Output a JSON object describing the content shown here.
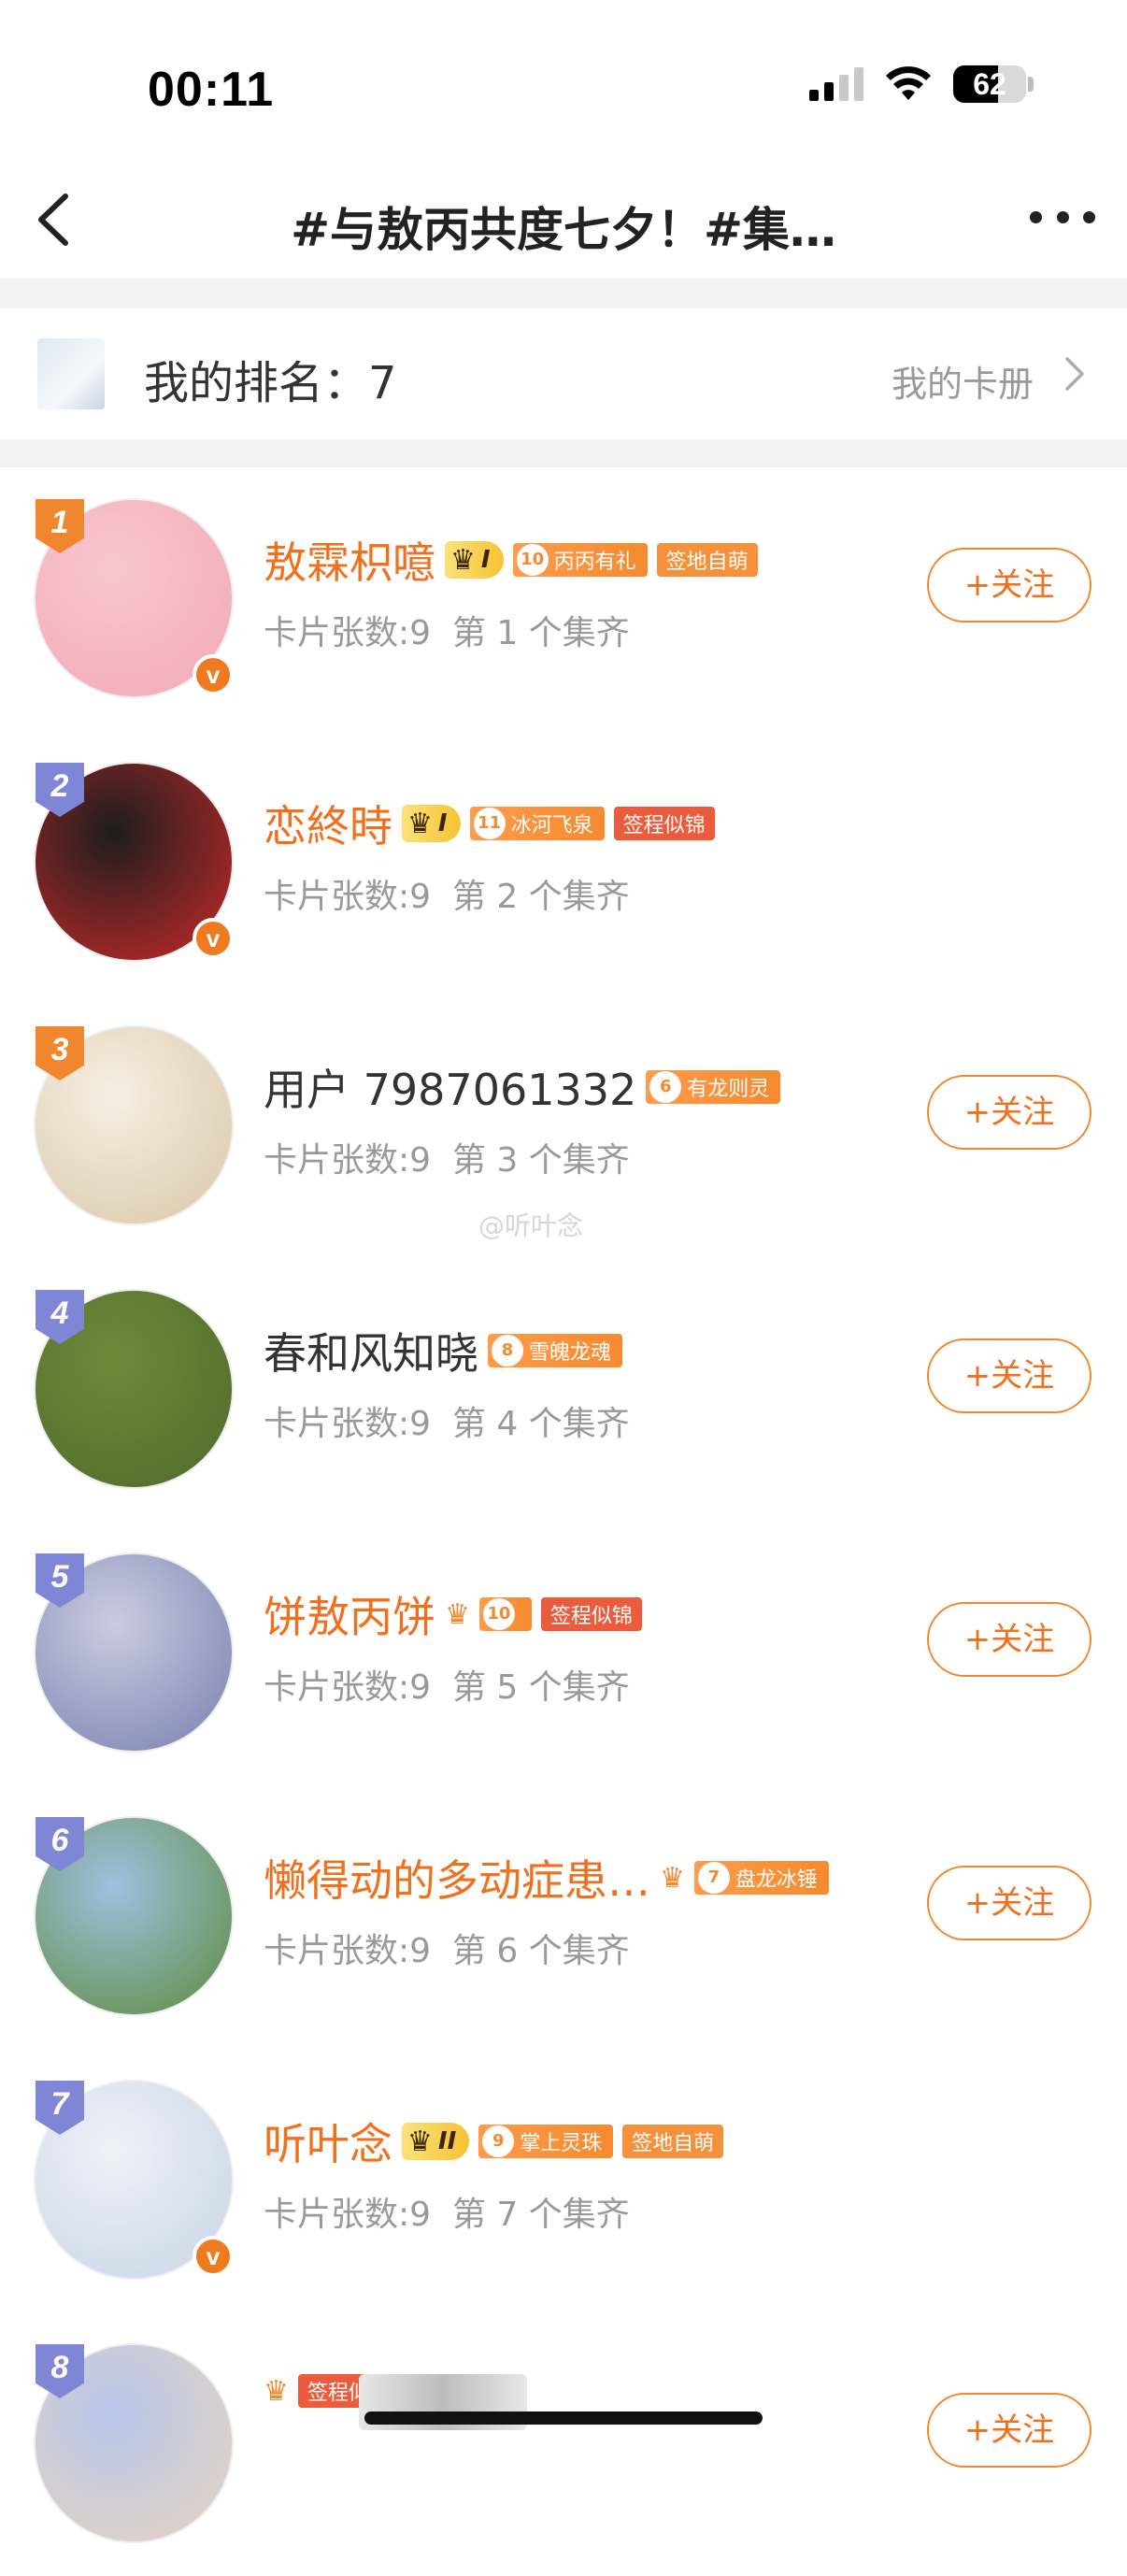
{
  "status_bar": {
    "time": "00:11",
    "battery": "62",
    "battery_fraction": 0.62
  },
  "nav": {
    "title": "#与敖丙共度七夕！#集…"
  },
  "my_rank": {
    "label": "我的排名：7",
    "link": "我的卡册"
  },
  "watermark": "@听叶念",
  "colors": {
    "accent": "#f0701e",
    "rank_top": "#f0862d",
    "rank_other": "#7f86d6"
  },
  "rows": [
    {
      "rank": "1",
      "name": "敖霖枳噫",
      "name_plain": false,
      "crown_level": "I",
      "fan_level": "10",
      "fan_label": "丙丙有礼",
      "tag": "签地自萌",
      "tag_color": "orange",
      "cards": "卡片张数:9",
      "complete": "第 1 个集齐",
      "follow": "+关注",
      "verified": true,
      "rank_color": "top",
      "avatar_colors": [
        "#f8c7cf",
        "#f3a8b6"
      ]
    },
    {
      "rank": "2",
      "name": "恋終時",
      "name_plain": false,
      "crown_level": "I",
      "fan_level": "11",
      "fan_label": "冰河飞泉",
      "tag": "签程似锦",
      "tag_color": "red",
      "cards": "卡片张数:9",
      "complete": "第 2 个集齐",
      "follow": "",
      "verified": true,
      "rank_color": "other",
      "avatar_colors": [
        "#1d1d1d",
        "#c92a2a"
      ]
    },
    {
      "rank": "3",
      "name": "用户 7987061332",
      "name_plain": true,
      "crown_level": "",
      "fan_level": "6",
      "fan_label": "有龙则灵",
      "tag": "",
      "tag_color": "",
      "cards": "卡片张数:9",
      "complete": "第 3 个集齐",
      "follow": "+关注",
      "verified": false,
      "rank_color": "top",
      "avatar_colors": [
        "#f6efe2",
        "#d9c7a8"
      ]
    },
    {
      "rank": "4",
      "name": "春和风知晓",
      "name_plain": true,
      "crown_level": "",
      "fan_level": "8",
      "fan_label": "雪魄龙魂",
      "tag": "",
      "tag_color": "",
      "cards": "卡片张数:9",
      "complete": "第 4 个集齐",
      "follow": "+关注",
      "verified": false,
      "rank_color": "other",
      "avatar_colors": [
        "#6d8a3a",
        "#4f6b2a"
      ]
    },
    {
      "rank": "5",
      "name": "饼敖丙饼",
      "name_plain": false,
      "crown_level": "",
      "fan_level": "10",
      "fan_label": "",
      "tag": "签程似锦",
      "tag_color": "red",
      "cards": "卡片张数:9",
      "complete": "第 5 个集齐",
      "follow": "+关注",
      "verified": false,
      "rank_color": "other",
      "avatar_colors": [
        "#c9cde0",
        "#7a7fb0"
      ]
    },
    {
      "rank": "6",
      "name": "懒得动的多动症患…",
      "name_plain": false,
      "crown_level": "",
      "fan_level": "7",
      "fan_label": "盘龙冰锤",
      "tag": "",
      "tag_color": "",
      "cards": "卡片张数:9",
      "complete": "第 6 个集齐",
      "follow": "+关注",
      "verified": false,
      "rank_color": "other",
      "avatar_colors": [
        "#9fc1e0",
        "#5f8a3f"
      ]
    },
    {
      "rank": "7",
      "name": "听叶念",
      "name_plain": false,
      "crown_level": "II",
      "fan_level": "9",
      "fan_label": "掌上灵珠",
      "tag": "签地自萌",
      "tag_color": "orange",
      "cards": "卡片张数:9",
      "complete": "第 7 个集齐",
      "follow": "",
      "verified": true,
      "rank_color": "other",
      "avatar_colors": [
        "#eef2f8",
        "#c8d4e6"
      ]
    },
    {
      "rank": "8",
      "name": "",
      "name_plain": false,
      "crown_level": "",
      "fan_level": "",
      "fan_label": "",
      "tag": "签程似锦",
      "tag_color": "red",
      "cards": "",
      "complete": "",
      "follow": "+关注",
      "verified": false,
      "rank_color": "other",
      "avatar_colors": [
        "#b7c6ea",
        "#e8d4c0"
      ]
    }
  ]
}
